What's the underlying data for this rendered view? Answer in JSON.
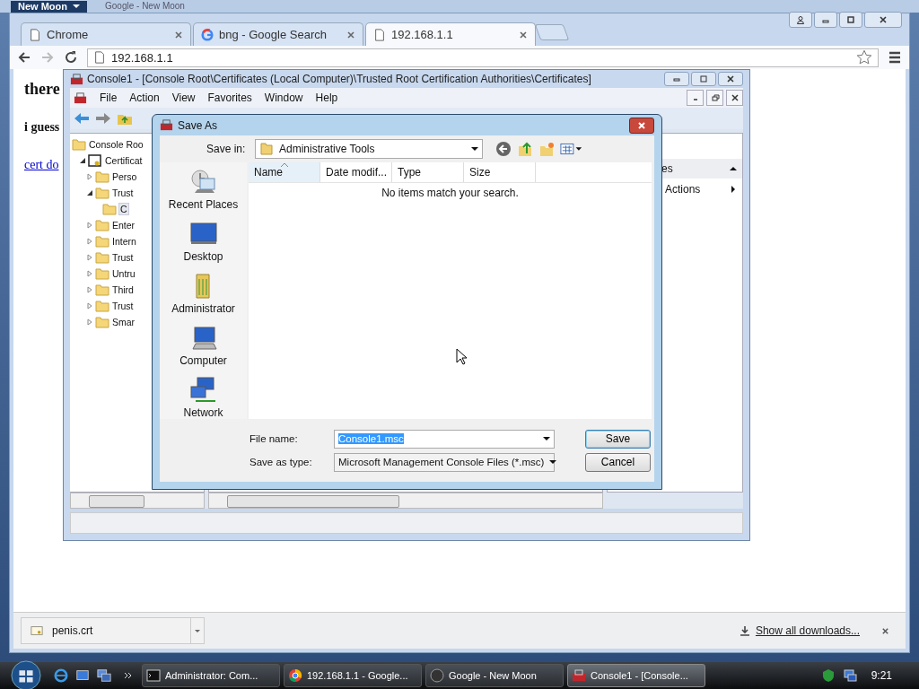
{
  "background_window": {
    "button": "New Moon",
    "title": "Google - New Moon"
  },
  "browser": {
    "tabs": [
      {
        "label": "Chrome",
        "selected": false,
        "kind": "page"
      },
      {
        "label": "bng - Google Search",
        "selected": false,
        "kind": "google"
      },
      {
        "label": "192.168.1.1",
        "selected": true,
        "kind": "page"
      }
    ],
    "address": "192.168.1.1",
    "page": [
      {
        "kind": "heading",
        "text": "there"
      },
      {
        "kind": "bold",
        "text": "i guess"
      },
      {
        "kind": "link",
        "text": "cert do"
      }
    ],
    "downloads": {
      "items": [
        {
          "name": "penis.crt"
        }
      ],
      "show_all": "Show all downloads..."
    }
  },
  "mmc": {
    "title": "Console1 - [Console Root\\Certificates (Local Computer)\\Trusted Root Certification Authorities\\Certificates]",
    "menu": [
      "File",
      "Action",
      "View",
      "Favorites",
      "Window",
      "Help"
    ],
    "tree": [
      {
        "label": "Console Roo",
        "kind": "folder",
        "selected": false,
        "children": [
          {
            "label": "Certificat",
            "kind": "snapin",
            "expanded": true,
            "selected": false,
            "children": [
              {
                "label": "Perso",
                "kind": "folder",
                "expanded": false,
                "selected": false
              },
              {
                "label": "Trust",
                "kind": "folder",
                "expanded": true,
                "selected": false,
                "children": [
                  {
                    "label": "C",
                    "kind": "folder",
                    "selected": true
                  }
                ]
              },
              {
                "label": "Enter",
                "kind": "folder",
                "expanded": false,
                "selected": false
              },
              {
                "label": "Intern",
                "kind": "folder",
                "expanded": false,
                "selected": false
              },
              {
                "label": "Trust",
                "kind": "folder",
                "expanded": false,
                "selected": false
              },
              {
                "label": "Untru",
                "kind": "folder",
                "expanded": false,
                "selected": false
              },
              {
                "label": "Third",
                "kind": "folder",
                "expanded": false,
                "selected": false
              },
              {
                "label": "Trust",
                "kind": "folder",
                "expanded": false,
                "selected": false
              },
              {
                "label": "Smar",
                "kind": "folder",
                "expanded": false,
                "selected": false
              }
            ]
          }
        ]
      }
    ],
    "actions": [
      {
        "kind": "header",
        "label": "es"
      },
      {
        "kind": "item",
        "label": "Actions"
      }
    ]
  },
  "save_dialog": {
    "title": "Save As",
    "save_in_label": "Save in:",
    "save_in": "Administrative Tools",
    "places": [
      {
        "kind": "recent",
        "label": "Recent Places"
      },
      {
        "kind": "desktop",
        "label": "Desktop"
      },
      {
        "kind": "user",
        "label": "Administrator"
      },
      {
        "kind": "computer",
        "label": "Computer"
      },
      {
        "kind": "network",
        "label": "Network"
      }
    ],
    "columns": [
      {
        "label": "Name",
        "sorted": true
      },
      {
        "label": "Date modif...",
        "sorted": false
      },
      {
        "label": "Type",
        "sorted": false
      },
      {
        "label": "Size",
        "sorted": false
      }
    ],
    "empty_message": "No items match your search.",
    "file_name_label": "File name:",
    "file_name": {
      "value": "Console1.msc",
      "selected": true
    },
    "type_label": "Save as type:",
    "type": "Microsoft Management Console Files (*.msc)",
    "buttons": [
      {
        "label": "Save",
        "default": true
      },
      {
        "label": "Cancel",
        "default": false
      }
    ]
  },
  "taskbar": {
    "tasks": [
      {
        "label": "Administrator: Com...",
        "kind": "console",
        "selected": false
      },
      {
        "label": "192.168.1.1 - Google...",
        "kind": "chrome",
        "selected": false
      },
      {
        "label": "Google - New Moon",
        "kind": "moon",
        "selected": false
      },
      {
        "label": "Console1 - [Console...",
        "kind": "mmc",
        "selected": true
      }
    ],
    "clock": "9:21"
  }
}
